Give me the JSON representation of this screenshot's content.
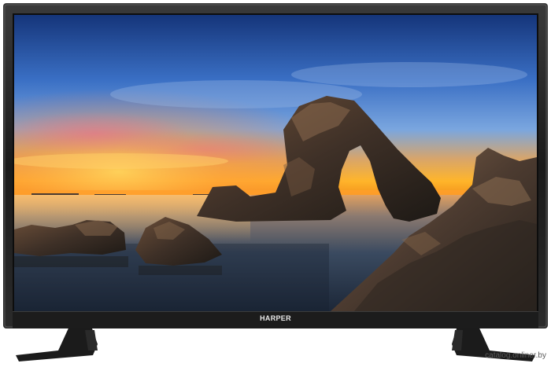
{
  "product": {
    "brand_logo": "HARPER",
    "device": "tv-set"
  },
  "screen": {
    "scene": "sunset-sea-rock-arch",
    "colors": {
      "sky_top": "#1c3e86",
      "sky_mid": "#4f86d3",
      "horizon_glow": "#ffb52a",
      "sea": "#2c3c52",
      "rock": "#3a2e25"
    }
  },
  "watermark": {
    "text": "catalog.onliner.by"
  }
}
